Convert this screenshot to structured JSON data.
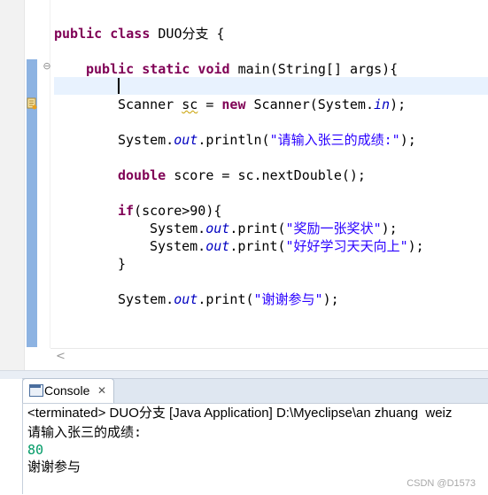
{
  "editor": {
    "lines": {
      "class_decl": {
        "kw": "public class",
        "rest": " DUO分支 {"
      },
      "main_decl": {
        "kw": "public static void",
        "rest": " main(String[] args){"
      },
      "scanner": {
        "a": "Scanner ",
        "b": "sc",
        "c": " = ",
        "kw": "new",
        "d": " Scanner(System.",
        "fld": "in",
        "e": ");"
      },
      "println": {
        "a": "System.",
        "fld": "out",
        "b": ".println(",
        "str": "\"请输入张三的成绩:\"",
        "c": ");"
      },
      "double": {
        "kw": "double",
        "rest": " score = sc.nextDouble();"
      },
      "if": {
        "kw": "if",
        "rest": "(score>90){"
      },
      "print1": {
        "a": "System.",
        "fld": "out",
        "b": ".print(",
        "str": "\"奖励一张奖状\"",
        "c": ");"
      },
      "print2": {
        "a": "System.",
        "fld": "out",
        "b": ".print(",
        "str": "\"好好学习天天向上\"",
        "c": ");"
      },
      "close_if": "}",
      "print3": {
        "a": "System.",
        "fld": "out",
        "b": ".print(",
        "str": "\"谢谢参与\"",
        "c": ");"
      }
    },
    "fold_icon": "⊖",
    "scroll_left_glyph": "<"
  },
  "console": {
    "tab_label": "Console",
    "close_glyph": "✕",
    "terminated": "<terminated> DUO分支 [Java Application] D:\\Myeclipse\\an zhuang  weiz",
    "output_prompt": "请输入张三的成绩:",
    "output_input": "80",
    "output_result": "谢谢参与"
  },
  "watermark": "CSDN @D1573",
  "colors": {
    "keyword": "#7f0055",
    "string": "#2a00ff",
    "field": "#0000c0",
    "console_input": "#009a66"
  }
}
